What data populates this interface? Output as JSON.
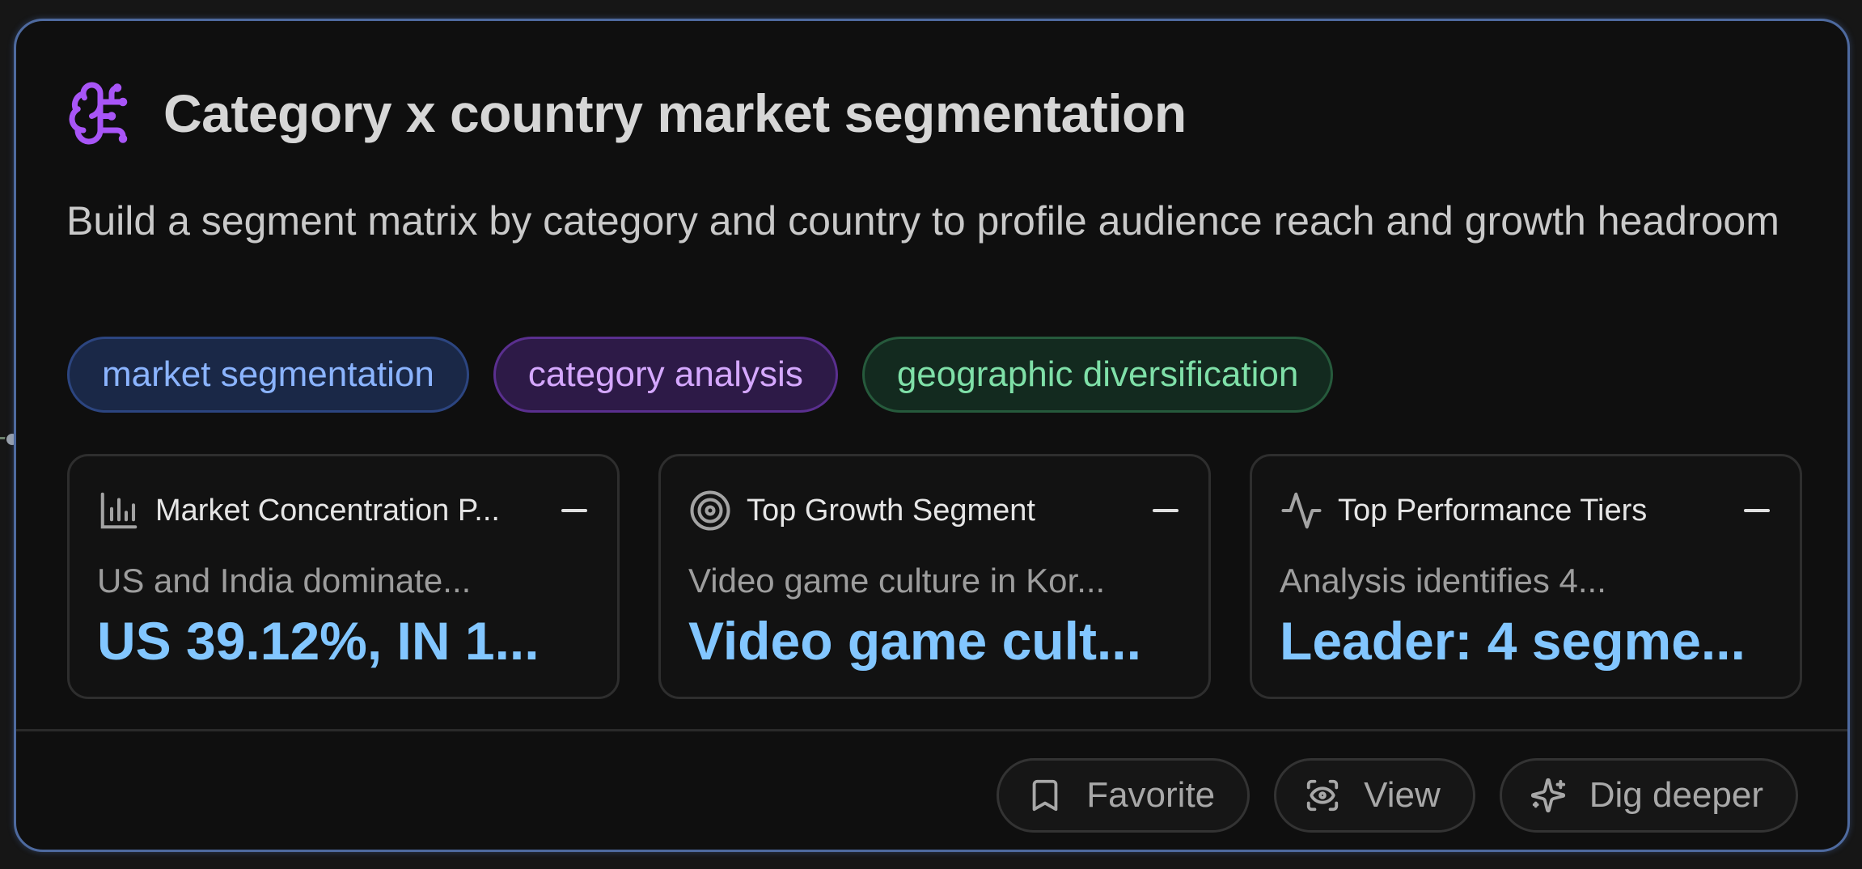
{
  "card": {
    "title": "Category x country market segmentation",
    "description": "Build a segment matrix by category and country to profile audience reach and growth headroom",
    "icon": "brain-icon",
    "accent_color": "#a855f7"
  },
  "tags": [
    {
      "label": "market segmentation",
      "color": "#8bb4ff"
    },
    {
      "label": "category analysis",
      "color": "#d5a8ff"
    },
    {
      "label": "geographic diversification",
      "color": "#7fe0a8"
    }
  ],
  "metrics": [
    {
      "icon": "bar-chart-icon",
      "title": "Market Concentration P...",
      "subtitle": "US and India dominate...",
      "value": "US 39.12%, IN 1..."
    },
    {
      "icon": "target-icon",
      "title": "Top Growth Segment",
      "subtitle": "Video game culture in Kor...",
      "value": "Video game cult..."
    },
    {
      "icon": "activity-icon",
      "title": "Top Performance Tiers",
      "subtitle": "Analysis identifies 4...",
      "value": "Leader: 4 segme..."
    }
  ],
  "actions": [
    {
      "label": "Favorite",
      "icon": "bookmark-icon"
    },
    {
      "label": "View",
      "icon": "eye-icon"
    },
    {
      "label": "Dig deeper",
      "icon": "sparkle-icon"
    }
  ],
  "value_color": "#82c6ff"
}
